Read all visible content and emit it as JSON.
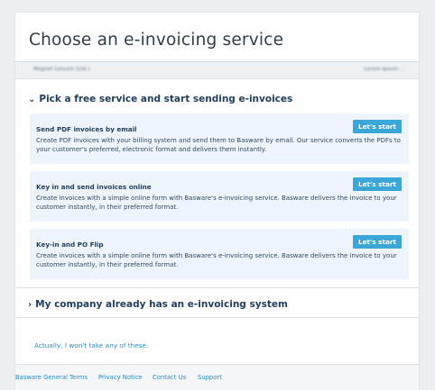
{
  "page": {
    "title": "Choose an e-invoicing service"
  },
  "subbar": {
    "left_text": "Magnet Leisure (Ltd.)",
    "right_text": "Lorem ipsum ..."
  },
  "free_section": {
    "heading": "Pick a free service and start sending e-invoices",
    "services": [
      {
        "title": "Send PDF invoices by email",
        "description": "Create PDF invoices with your billing system and send them to Basware by email. Our service converts the PDFs to your customer's preferred, electronic format and delivers them instantly.",
        "button": "Let's start"
      },
      {
        "title": "Key in and send invoices online",
        "description": "Create invoices with a simple online form with Basware's e-invoicing service. Basware delivers the invoice to your customer instantly, in their preferred format.",
        "button": "Let's start"
      },
      {
        "title": "Key-in and PO Flip",
        "description": "Create invoices with a simple online form with Basware's e-invoicing service. Basware delivers the invoice to your customer instantly, in their preferred format.",
        "button": "Let's start"
      }
    ]
  },
  "existing_section": {
    "heading": "My company already has an e-invoicing system"
  },
  "decline_link": "Actually, I won't take any of these.",
  "footer": {
    "links": [
      "Basware General Terms",
      "Privacy Notice",
      "Contact Us",
      "Support"
    ]
  },
  "colors": {
    "accent": "#3ba7d8",
    "link": "#2a8cc0",
    "service_bg": "#edf4fb",
    "heading": "#1f3d5c"
  }
}
